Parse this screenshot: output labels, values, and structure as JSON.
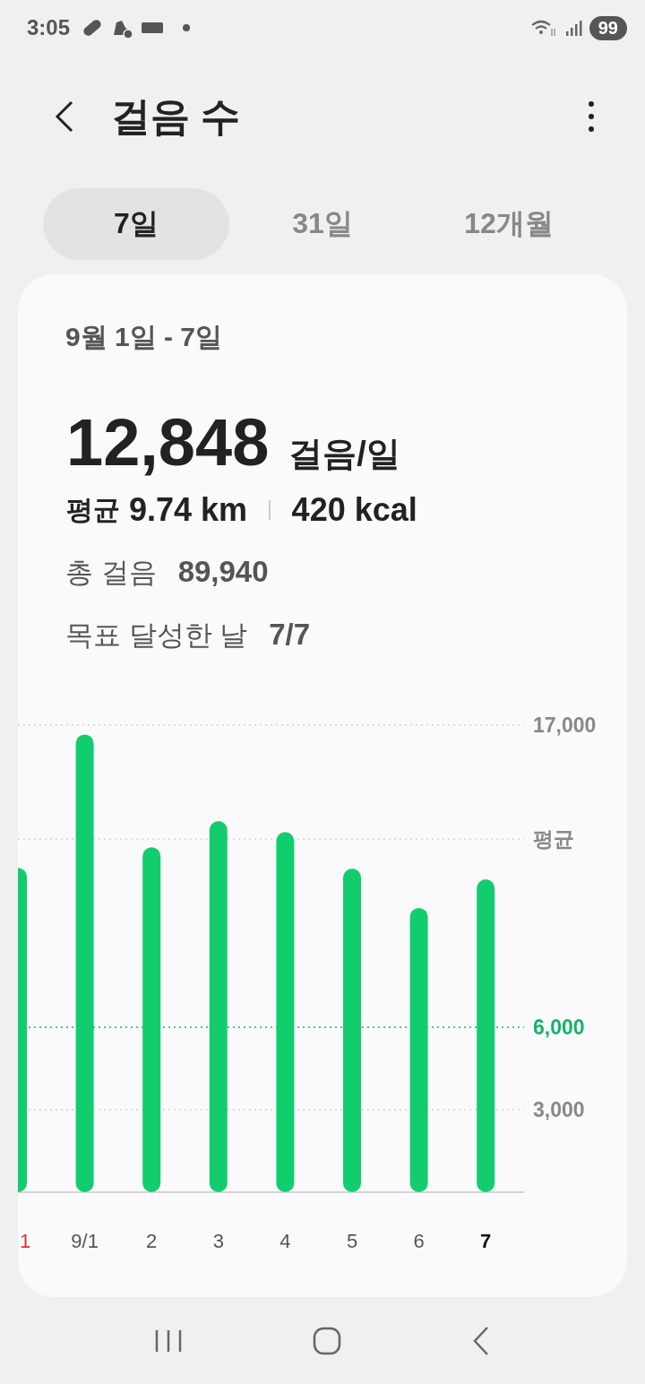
{
  "status_bar": {
    "time": "3:05",
    "battery": "99"
  },
  "header": {
    "title": "걸음 수"
  },
  "tabs": [
    {
      "label": "7일",
      "selected": true
    },
    {
      "label": "31일",
      "selected": false
    },
    {
      "label": "12개월",
      "selected": false
    }
  ],
  "summary": {
    "date_range": "9월 1일 - 7일",
    "daily_steps": "12,848",
    "daily_unit": "걸음/일",
    "average_label": "평균",
    "distance": "9.74 km",
    "calories": "420 kcal",
    "total_label": "총 걸음",
    "total_value": "89,940",
    "goal_label": "목표 달성한 날",
    "goal_value": "7/7"
  },
  "chart": {
    "days": [
      {
        "kind": "sunday"
      },
      {
        "kind": "weekday"
      },
      {
        "kind": "weekday"
      },
      {
        "kind": "weekday"
      },
      {
        "kind": "weekday"
      },
      {
        "kind": "weekday"
      },
      {
        "kind": "weekday"
      },
      {
        "kind": "today"
      }
    ],
    "chart_data": {
      "type": "bar",
      "categories": [
        "1",
        "9/1",
        "2",
        "3",
        "4",
        "5",
        "6",
        "7"
      ],
      "values": [
        11800,
        16650,
        12550,
        13500,
        13100,
        11770,
        10340,
        11380
      ],
      "ylim": [
        0,
        17000
      ],
      "yticks": [
        {
          "value": 3000,
          "label": "3,000"
        },
        {
          "value": 6000,
          "label": "6,000"
        },
        {
          "value": 17000,
          "label": "17,000"
        }
      ],
      "ref_lines": [
        {
          "axis": "y",
          "value": 17000
        },
        {
          "axis": "y",
          "value": 12848,
          "label": "평균"
        },
        {
          "axis": "y",
          "value": 6000,
          "color": "#17b26a"
        },
        {
          "axis": "y",
          "value": 3000
        }
      ]
    }
  }
}
